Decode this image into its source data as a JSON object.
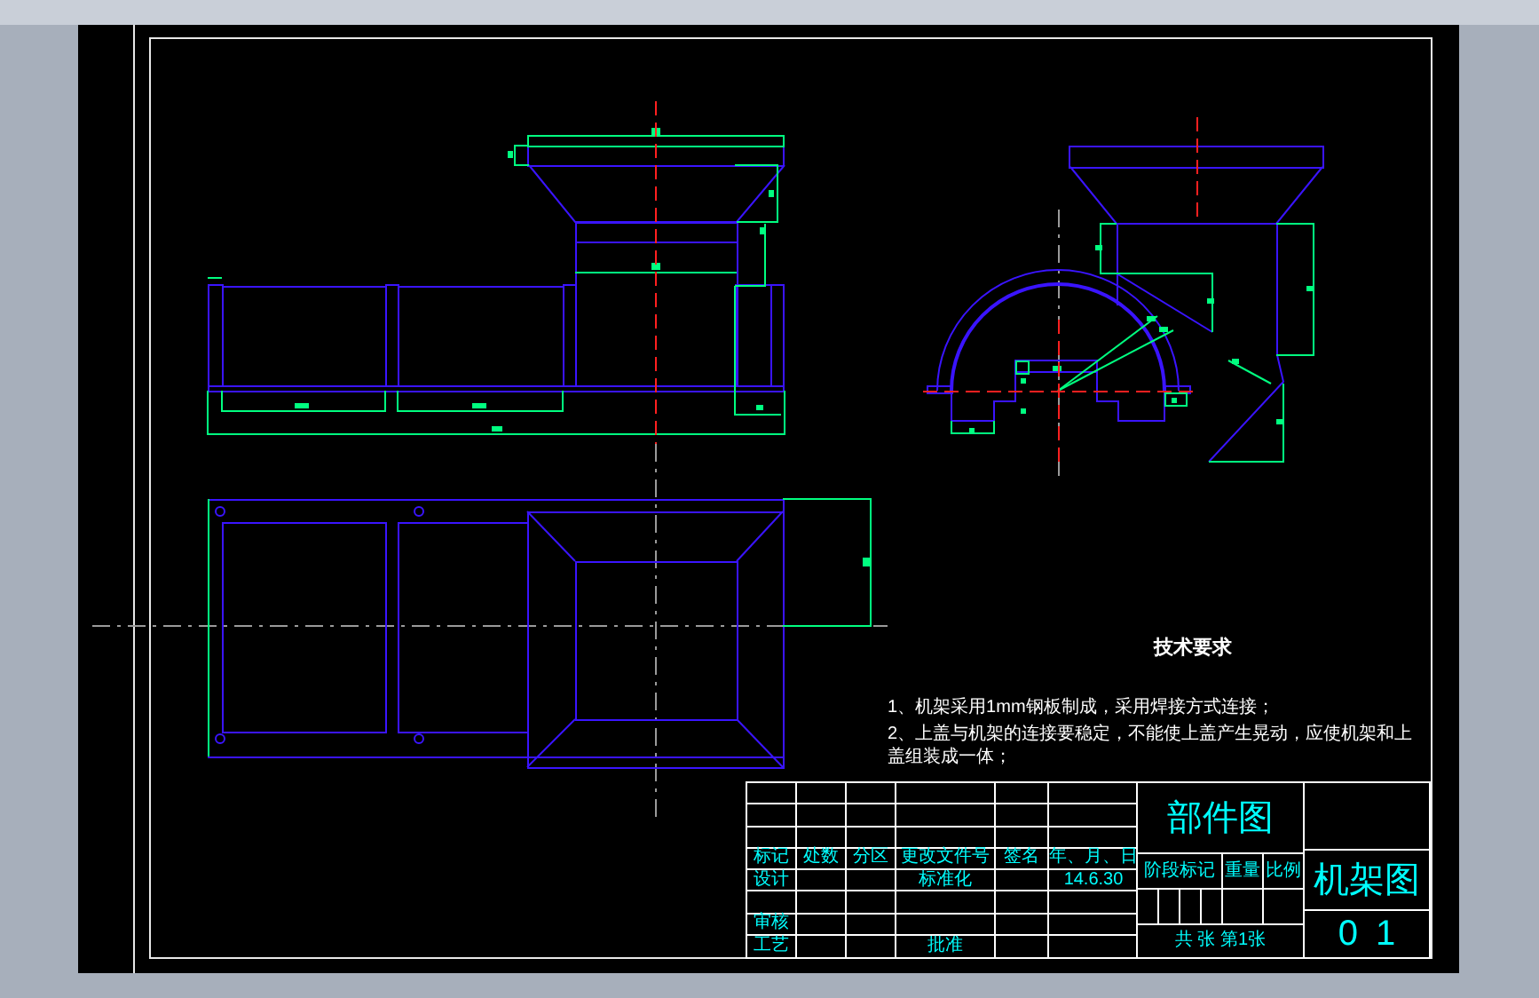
{
  "technical_requirements": {
    "title": "技术要求",
    "items": [
      "1、机架采用1mm钢板制成，采用焊接方式连接；",
      "2、上盖与机架的连接要稳定，不能使上盖产生晃动，应使机架和上盖组装成一体；"
    ]
  },
  "title_block": {
    "header": [
      "标记",
      "处数",
      "分区",
      "更改文件号",
      "签名",
      "年、月、日"
    ],
    "design": "设计",
    "standardization": "标准化",
    "date": "14.6.30",
    "review": "审核",
    "process": "工艺",
    "approval": "批准",
    "drawing_type": "部件图",
    "stage_mark": "阶段标记",
    "weight": "重量",
    "scale": "比例",
    "sheet_info": "共 张 第1张",
    "drawing_name": "机架图",
    "drawing_number": "01"
  }
}
